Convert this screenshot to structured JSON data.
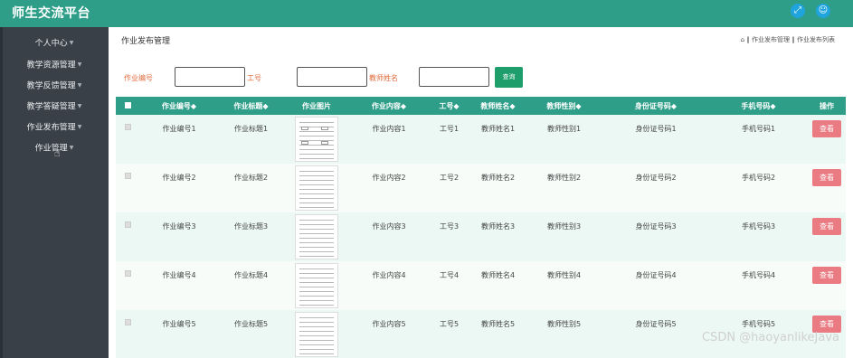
{
  "app": {
    "title": "师生交流平台"
  },
  "header_icons": [
    {
      "name": "fullscreen-icon",
      "glyph": "⤢"
    },
    {
      "name": "user-icon",
      "glyph": "☺"
    }
  ],
  "sidebar": {
    "items": [
      {
        "label": "个人中心"
      },
      {
        "label": "教学资源管理"
      },
      {
        "label": "教学反馈管理"
      },
      {
        "label": "教学答疑管理"
      },
      {
        "label": "作业发布管理"
      },
      {
        "label": "作业管理"
      }
    ]
  },
  "page": {
    "title": "作业发布管理",
    "breadcrumb": "⌂ ‖ 作业发布管理 ‖ 作业发布列表"
  },
  "search": {
    "fields": [
      {
        "label": "作业编号",
        "value": ""
      },
      {
        "label": "工号",
        "value": ""
      },
      {
        "label": "教师姓名",
        "value": ""
      }
    ],
    "button_label": "查询"
  },
  "table": {
    "headers": [
      "作业编号◆",
      "作业标题◆",
      "作业图片",
      "作业内容◆",
      "工号◆",
      "教师姓名◆",
      "教师性别◆",
      "身份证号码◆",
      "手机号码◆",
      "操作"
    ],
    "rows": [
      {
        "id": "作业编号1",
        "title": "作业标题1",
        "content": "作业内容1",
        "gh": "工号1",
        "name": "教师姓名1",
        "gender": "教师性别1",
        "idcard": "身份证号码1",
        "phone": "手机号码1",
        "action": "查看"
      },
      {
        "id": "作业编号2",
        "title": "作业标题2",
        "content": "作业内容2",
        "gh": "工号2",
        "name": "教师姓名2",
        "gender": "教师性别2",
        "idcard": "身份证号码2",
        "phone": "手机号码2",
        "action": "查看"
      },
      {
        "id": "作业编号3",
        "title": "作业标题3",
        "content": "作业内容3",
        "gh": "工号3",
        "name": "教师姓名3",
        "gender": "教师性别3",
        "idcard": "身份证号码3",
        "phone": "手机号码3",
        "action": "查看"
      },
      {
        "id": "作业编号4",
        "title": "作业标题4",
        "content": "作业内容4",
        "gh": "工号4",
        "name": "教师姓名4",
        "gender": "教师性别4",
        "idcard": "身份证号码4",
        "phone": "手机号码4",
        "action": "查看"
      },
      {
        "id": "作业编号5",
        "title": "作业标题5",
        "content": "作业内容5",
        "gh": "工号5",
        "name": "教师姓名5",
        "gender": "教师性别5",
        "idcard": "身份证号码5",
        "phone": "手机号码5",
        "action": "查看"
      }
    ]
  },
  "watermark": "CSDN @haoyanlikeJava",
  "colors": {
    "primary": "#2e9e88",
    "sidebar": "#394048",
    "view_button": "#ea7b82",
    "search_button": "#1e9e6a",
    "search_label": "#e06a3a"
  }
}
